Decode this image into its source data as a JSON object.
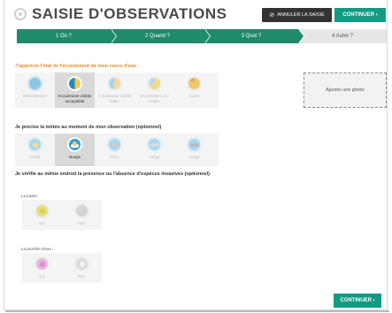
{
  "header": {
    "title": "SAISIE D'OBSERVATIONS",
    "cancel_label": "ANNULER LA SAISIE",
    "continue_label": "CONTINUER ›"
  },
  "steps": [
    {
      "label": "1 Où ?",
      "state": "done"
    },
    {
      "label": "2 Quand ?",
      "state": "done"
    },
    {
      "label": "3 Quoi ?",
      "state": "done"
    },
    {
      "label": "4 Autre ?",
      "state": "todo"
    }
  ],
  "flow": {
    "title": "J'apprécie l'état de l'écoulement de mon cours d'eau",
    "options": [
      {
        "label": "Débordement",
        "selected": false
      },
      {
        "label": "Ecoulement visible acceptable",
        "selected": true
      },
      {
        "label": "Ecoulement visible faible",
        "selected": false
      },
      {
        "label": "Ecoulement non visible",
        "selected": false
      },
      {
        "label": "Assec",
        "selected": false
      }
    ]
  },
  "photo": {
    "label": "Ajouter une photo"
  },
  "weather": {
    "title": "Je précise la météo au moment de mon observation (optionnel)",
    "options": [
      {
        "label": "Soleil",
        "selected": false
      },
      {
        "label": "Nuage",
        "selected": true
      },
      {
        "label": "Pluie",
        "selected": false
      },
      {
        "label": "Neige",
        "selected": false
      },
      {
        "label": "Orage",
        "selected": false
      }
    ]
  },
  "invasive": {
    "title": "Je vérifie au même endroit la présence ou l'absence d'espèces invasives (optionnel)",
    "species": [
      {
        "name": "La jussie :",
        "yes": "Oui",
        "no": "Non"
      },
      {
        "name": "La jacinthe d'eau :",
        "yes": "Oui",
        "no": "Non"
      }
    ]
  },
  "footer": {
    "continue_label": "CONTINUER ›"
  },
  "colors": {
    "accent": "#109b84",
    "step_done": "#1f8a6c",
    "orange_title": "#e98b2a"
  }
}
